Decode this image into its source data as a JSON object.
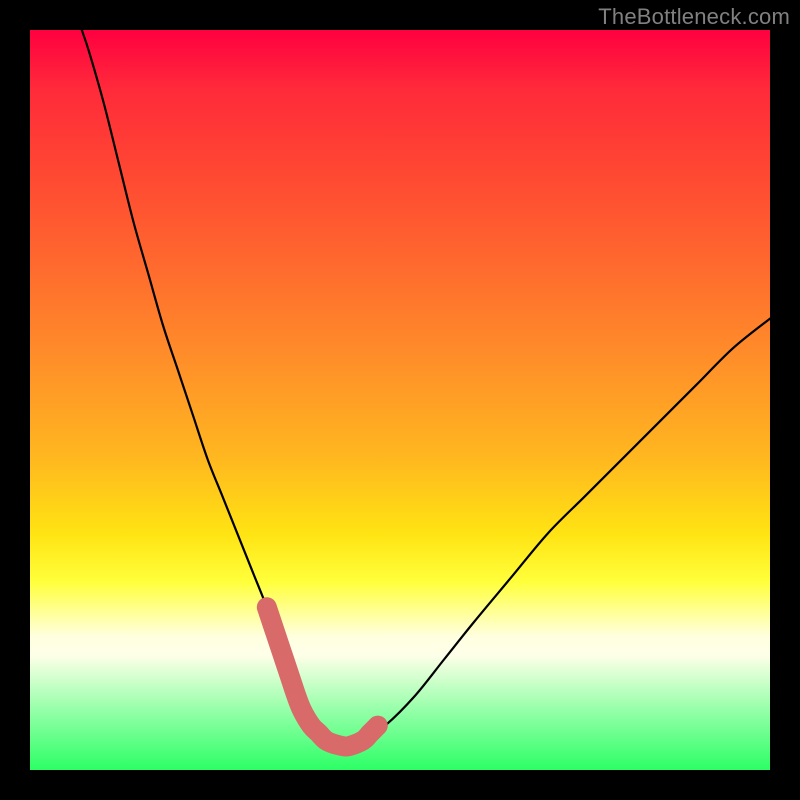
{
  "watermark": {
    "text": "TheBottleneck.com"
  },
  "chart_data": {
    "type": "line",
    "title": "",
    "xlabel": "",
    "ylabel": "",
    "xlim": [
      0,
      100
    ],
    "ylim": [
      0,
      100
    ],
    "grid": false,
    "legend": false,
    "annotations": [],
    "series": [
      {
        "name": "bottleneck-curve",
        "color": "#000000",
        "x": [
          7,
          8,
          10,
          12,
          14,
          16,
          18,
          20,
          22,
          24,
          26,
          28,
          30,
          32,
          33,
          34,
          35,
          36,
          36.8,
          38,
          39,
          40,
          41.5,
          43,
          45,
          48,
          52,
          56,
          60,
          65,
          70,
          75,
          80,
          85,
          90,
          95,
          100
        ],
        "y": [
          100,
          97,
          90,
          82,
          74,
          67,
          60,
          54,
          48,
          42,
          37,
          32,
          27,
          22,
          19,
          16,
          13,
          10,
          8,
          6,
          5,
          4,
          3.4,
          3.2,
          4,
          6,
          10,
          15,
          20,
          26,
          32,
          37,
          42,
          47,
          52,
          57,
          61
        ]
      },
      {
        "name": "optimal-range-highlight",
        "color": "#d86a6a",
        "x": [
          32,
          33,
          34,
          35,
          36,
          36.8,
          38,
          39,
          40,
          41.5,
          43,
          45,
          46,
          47
        ],
        "y": [
          22,
          19,
          16,
          13,
          10,
          8,
          6,
          5,
          4,
          3.4,
          3.2,
          4,
          5,
          6
        ]
      }
    ]
  }
}
